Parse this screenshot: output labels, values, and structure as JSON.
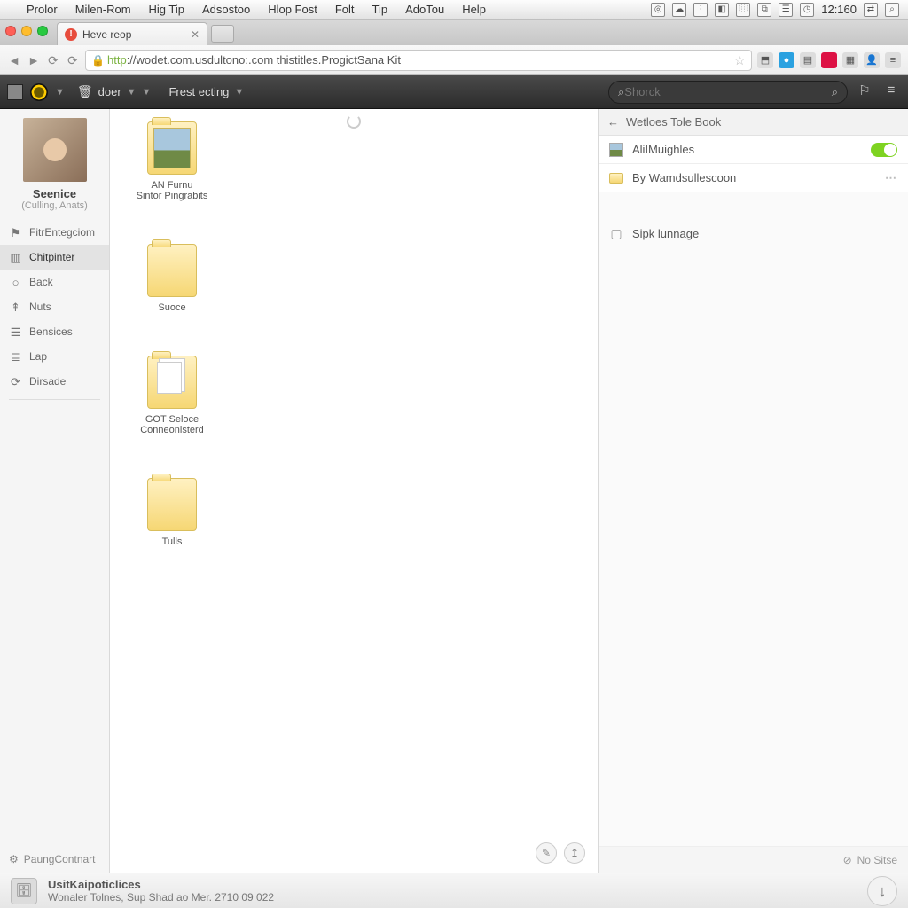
{
  "menubar": {
    "items": [
      "Prolor",
      "Milen-Rom",
      "Hig Tip",
      "Adsostoo",
      "Hlop Fost",
      "Folt",
      "Tip",
      "AdoTou",
      "Help"
    ],
    "clock": "12:160"
  },
  "browser": {
    "tab_title": "Heve reop",
    "url_proto": "http",
    "url_rest": "://wodet.com.usdultono:.com thistitles.ProgictSana Kit"
  },
  "toolbar": {
    "doer": "doer",
    "menu2": "Frest ecting",
    "search_ph": "Shorck"
  },
  "sidebar": {
    "user_name": "Seenice",
    "user_sub": "(Culling, Anats)",
    "items": [
      {
        "label": "FitrEntegciom"
      },
      {
        "label": "Chitpinter"
      },
      {
        "label": "Back"
      },
      {
        "label": "Nuts"
      },
      {
        "label": "Bensices"
      },
      {
        "label": "Lap"
      },
      {
        "label": "Dirsade"
      }
    ],
    "footer": "PaungContnart"
  },
  "files": [
    {
      "name": "AN Furnu",
      "sub": "Sintor Pingrabits",
      "kind": "photo"
    },
    {
      "name": "Suoce",
      "sub": "",
      "kind": "folder"
    },
    {
      "name": "GOT Seloce",
      "sub": "Conneonlsterd",
      "kind": "pages"
    },
    {
      "name": "Tulls",
      "sub": "",
      "kind": "folder"
    }
  ],
  "bottom": {
    "title": "UsitKaipoticlices",
    "sub": "Wonaler Tolnes, Sup Shad ao Mer. 2710 09 022"
  },
  "rpanel": {
    "header": "Wetloes Tole Book",
    "rows": [
      {
        "label": "AliIMuighles",
        "toggle": true
      },
      {
        "label": "By Wamdsullescoon",
        "more": true
      }
    ],
    "extra": {
      "label": "Sipk lunnage"
    },
    "footer": "No Sitse"
  }
}
